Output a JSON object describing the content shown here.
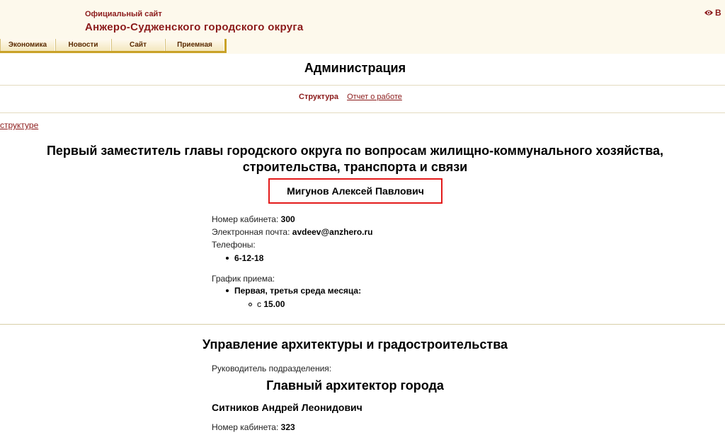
{
  "header": {
    "site_subtitle": "Официальный сайт",
    "site_title": "Анжеро-Судженского городского округа",
    "top_right_label": "В"
  },
  "menu": [
    "Экономика",
    "Новости",
    "Сайт",
    "Приемная"
  ],
  "page": {
    "title": "Администрация",
    "subnav_active": "Структура",
    "subnav_link": "Отчет о работе",
    "back_link": "структуре"
  },
  "section1": {
    "position_line1": "Первый заместитель главы городского округа по вопросам жилищно-коммунального хозяйства,",
    "position_line2": "строительства, транспорта и связи",
    "person_name": "Мигунов Алексей Павлович",
    "room_label": "Номер кабинета:",
    "room_value": "300",
    "email_label": "Электронная почта:",
    "email_value": "avdeev@anzhero.ru",
    "phones_label": "Телефоны:",
    "phone": "6-12-18",
    "schedule_label": "График приема:",
    "schedule_day": "Первая, третья среда месяца:",
    "schedule_from_label": "с",
    "schedule_from_value": "15.00"
  },
  "section2": {
    "title": "Управление архитектуры и градостроительства",
    "head_label": "Руководитель подразделения:",
    "head_position": "Главный архитектор города",
    "person_name": "Ситников Андрей Леонидович",
    "room_label": "Номер кабинета:",
    "room_value": "323"
  },
  "colors": {
    "brand": "#8b1a1a",
    "highlight_border": "#e31b1b",
    "menu_border": "#c9a227"
  }
}
